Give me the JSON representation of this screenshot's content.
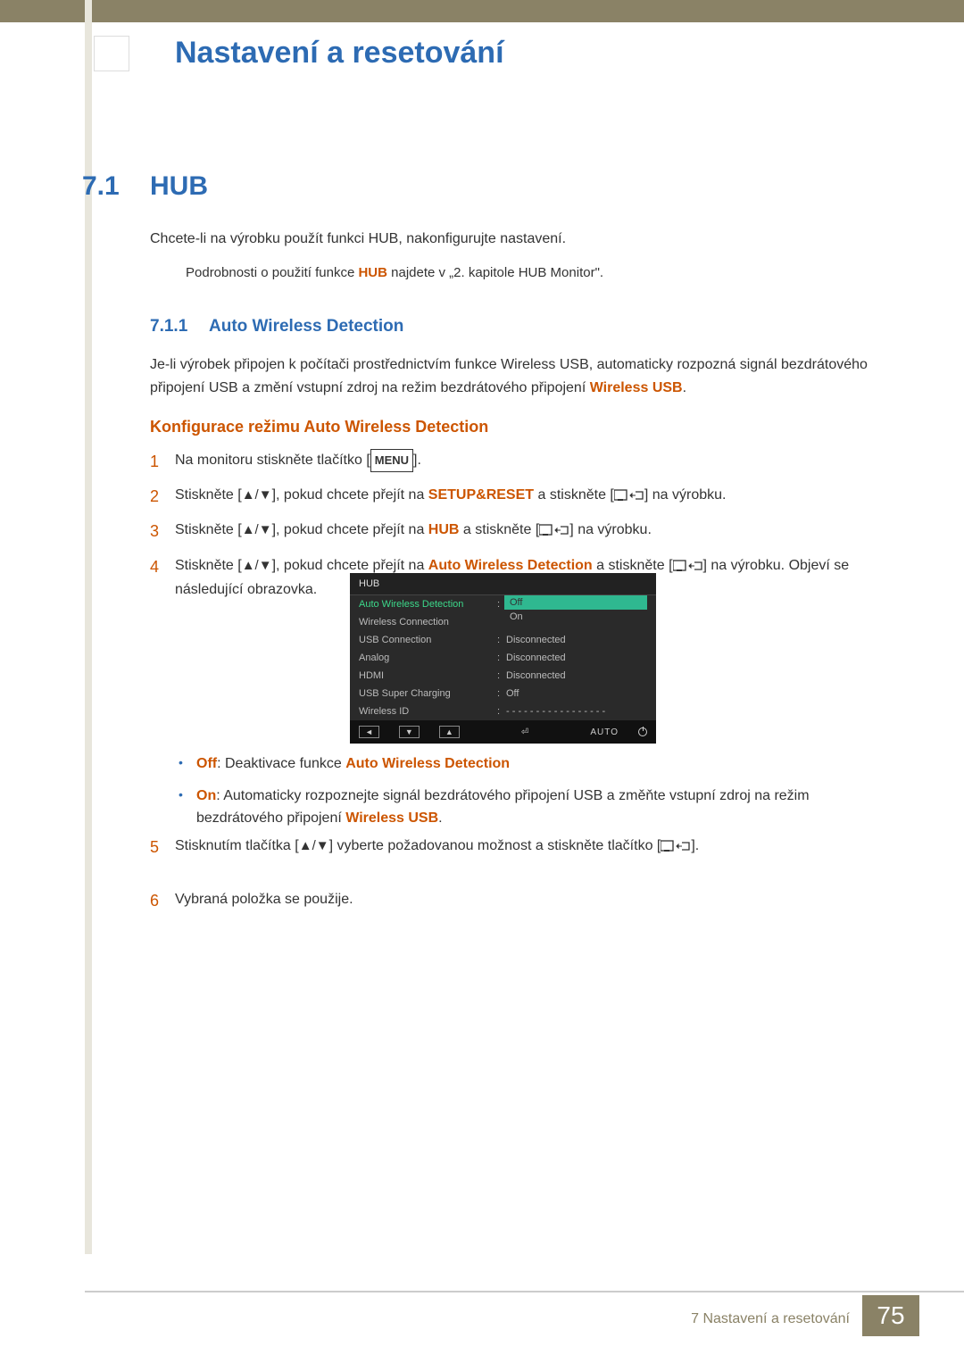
{
  "header": {
    "chapter_title": "Nastavení a resetování"
  },
  "section": {
    "num": "7.1",
    "title": "HUB",
    "intro": "Chcete-li na výrobku použít funkci HUB, nakonfigurujte nastavení."
  },
  "note": {
    "pre": "Podrobnosti o použití funkce ",
    "hub": "HUB",
    "post": " najdete v „2. kapitole HUB Monitor\"."
  },
  "subsection": {
    "num": "7.1.1",
    "title": "Auto Wireless Detection",
    "text_pre": "Je-li výrobek připojen k počítači prostřednictvím funkce Wireless USB, automaticky rozpozná signál bezdrátového připojení USB a změní vstupní zdroj na režim bezdrátového připojení ",
    "text_bold": "Wireless USB",
    "text_post": "."
  },
  "config": {
    "title": "Konfigurace režimu Auto Wireless Detection"
  },
  "steps": {
    "s1": {
      "n": "1",
      "pre": "Na monitoru stiskněte tlačítko [",
      "menu": "MENU",
      "post": "]."
    },
    "s2": {
      "n": "2",
      "pre": "Stiskněte [",
      "mid": "], pokud chcete přejít na ",
      "bold": "SETUP&RESET",
      "post1": " a stiskněte [",
      "post2": "] na výrobku."
    },
    "s3": {
      "n": "3",
      "pre": "Stiskněte [",
      "mid": "], pokud chcete přejít na ",
      "bold": "HUB",
      "post1": " a stiskněte [",
      "post2": "] na výrobku."
    },
    "s4": {
      "n": "4",
      "pre": "Stiskněte [",
      "mid": "], pokud chcete přejít na ",
      "bold": "Auto Wireless Detection",
      "post1": " a stiskněte [",
      "post2": "] na výrobku. Objeví se následující obrazovka."
    },
    "s5": {
      "n": "5",
      "pre": "Stisknutím tlačítka [",
      "mid": "] vyberte požadovanou možnost a stiskněte tlačítko [",
      "post": "]."
    },
    "s6": {
      "n": "6",
      "text": "Vybraná položka se použije."
    }
  },
  "osd": {
    "title": "HUB",
    "rows": [
      {
        "label": "Auto Wireless Detection",
        "active": true
      },
      {
        "label": "Wireless Connection",
        "val": ""
      },
      {
        "label": "USB Connection",
        "val": "Disconnected"
      },
      {
        "label": "Analog",
        "val": "Disconnected"
      },
      {
        "label": "HDMI",
        "val": "Disconnected"
      },
      {
        "label": "USB Super Charging",
        "val": "Off"
      },
      {
        "label": "Wireless ID",
        "val": "- - - - - - - - - - - - - - - - -"
      }
    ],
    "options": {
      "off": "Off",
      "on": "On"
    },
    "footer_auto": "AUTO"
  },
  "bullets": {
    "b1_bold": "Off",
    "b1_mid": ": Deaktivace funkce ",
    "b1_bold2": "Auto Wireless Detection",
    "b2_bold": "On",
    "b2_mid": ": Automaticky rozpoznejte signál bezdrátového připojení USB a změňte vstupní zdroj na režim bezdrátového připojení ",
    "b2_bold2": "Wireless USB",
    "b2_post": "."
  },
  "footer": {
    "text": "7 Nastavení a resetování",
    "page": "75"
  }
}
